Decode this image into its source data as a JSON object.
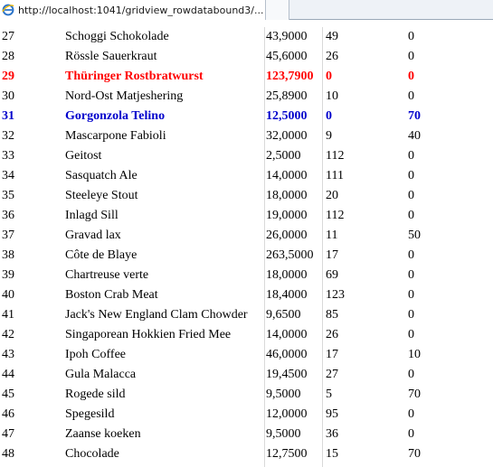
{
  "browser": {
    "tab_title": "http://localhost:1041/gridview_rowdatabound3/..."
  },
  "grid": {
    "rows": [
      {
        "id": "27",
        "name": "Schoggi Schokolade",
        "price": "43,9000",
        "stock": "49",
        "order": "0",
        "style": "normal"
      },
      {
        "id": "28",
        "name": "Rössle Sauerkraut",
        "price": "45,6000",
        "stock": "26",
        "order": "0",
        "style": "normal"
      },
      {
        "id": "29",
        "name": "Thüringer Rostbratwurst",
        "price": "123,7900",
        "stock": "0",
        "order": "0",
        "style": "red"
      },
      {
        "id": "30",
        "name": "Nord-Ost Matjeshering",
        "price": "25,8900",
        "stock": "10",
        "order": "0",
        "style": "normal"
      },
      {
        "id": "31",
        "name": "Gorgonzola Telino",
        "price": "12,5000",
        "stock": "0",
        "order": "70",
        "style": "blue"
      },
      {
        "id": "32",
        "name": "Mascarpone Fabioli",
        "price": "32,0000",
        "stock": "9",
        "order": "40",
        "style": "normal"
      },
      {
        "id": "33",
        "name": "Geitost",
        "price": "2,5000",
        "stock": "112",
        "order": "0",
        "style": "normal"
      },
      {
        "id": "34",
        "name": "Sasquatch Ale",
        "price": "14,0000",
        "stock": "111",
        "order": "0",
        "style": "normal"
      },
      {
        "id": "35",
        "name": "Steeleye Stout",
        "price": "18,0000",
        "stock": "20",
        "order": "0",
        "style": "normal"
      },
      {
        "id": "36",
        "name": "Inlagd Sill",
        "price": "19,0000",
        "stock": "112",
        "order": "0",
        "style": "normal"
      },
      {
        "id": "37",
        "name": "Gravad lax",
        "price": "26,0000",
        "stock": "11",
        "order": "50",
        "style": "normal"
      },
      {
        "id": "38",
        "name": "Côte de Blaye",
        "price": "263,5000",
        "stock": "17",
        "order": "0",
        "style": "normal"
      },
      {
        "id": "39",
        "name": "Chartreuse verte",
        "price": "18,0000",
        "stock": "69",
        "order": "0",
        "style": "normal"
      },
      {
        "id": "40",
        "name": "Boston Crab Meat",
        "price": "18,4000",
        "stock": "123",
        "order": "0",
        "style": "normal"
      },
      {
        "id": "41",
        "name": "Jack's New England Clam Chowder",
        "price": "9,6500",
        "stock": "85",
        "order": "0",
        "style": "normal"
      },
      {
        "id": "42",
        "name": "Singaporean Hokkien Fried Mee",
        "price": "14,0000",
        "stock": "26",
        "order": "0",
        "style": "normal"
      },
      {
        "id": "43",
        "name": "Ipoh Coffee",
        "price": "46,0000",
        "stock": "17",
        "order": "10",
        "style": "normal"
      },
      {
        "id": "44",
        "name": "Gula Malacca",
        "price": "19,4500",
        "stock": "27",
        "order": "0",
        "style": "normal"
      },
      {
        "id": "45",
        "name": "Rogede sild",
        "price": "9,5000",
        "stock": "5",
        "order": "70",
        "style": "normal"
      },
      {
        "id": "46",
        "name": "Spegesild",
        "price": "12,0000",
        "stock": "95",
        "order": "0",
        "style": "normal"
      },
      {
        "id": "47",
        "name": "Zaanse koeken",
        "price": "9,5000",
        "stock": "36",
        "order": "0",
        "style": "normal"
      },
      {
        "id": "48",
        "name": "Chocolade",
        "price": "12,7500",
        "stock": "15",
        "order": "70",
        "style": "normal"
      }
    ]
  }
}
